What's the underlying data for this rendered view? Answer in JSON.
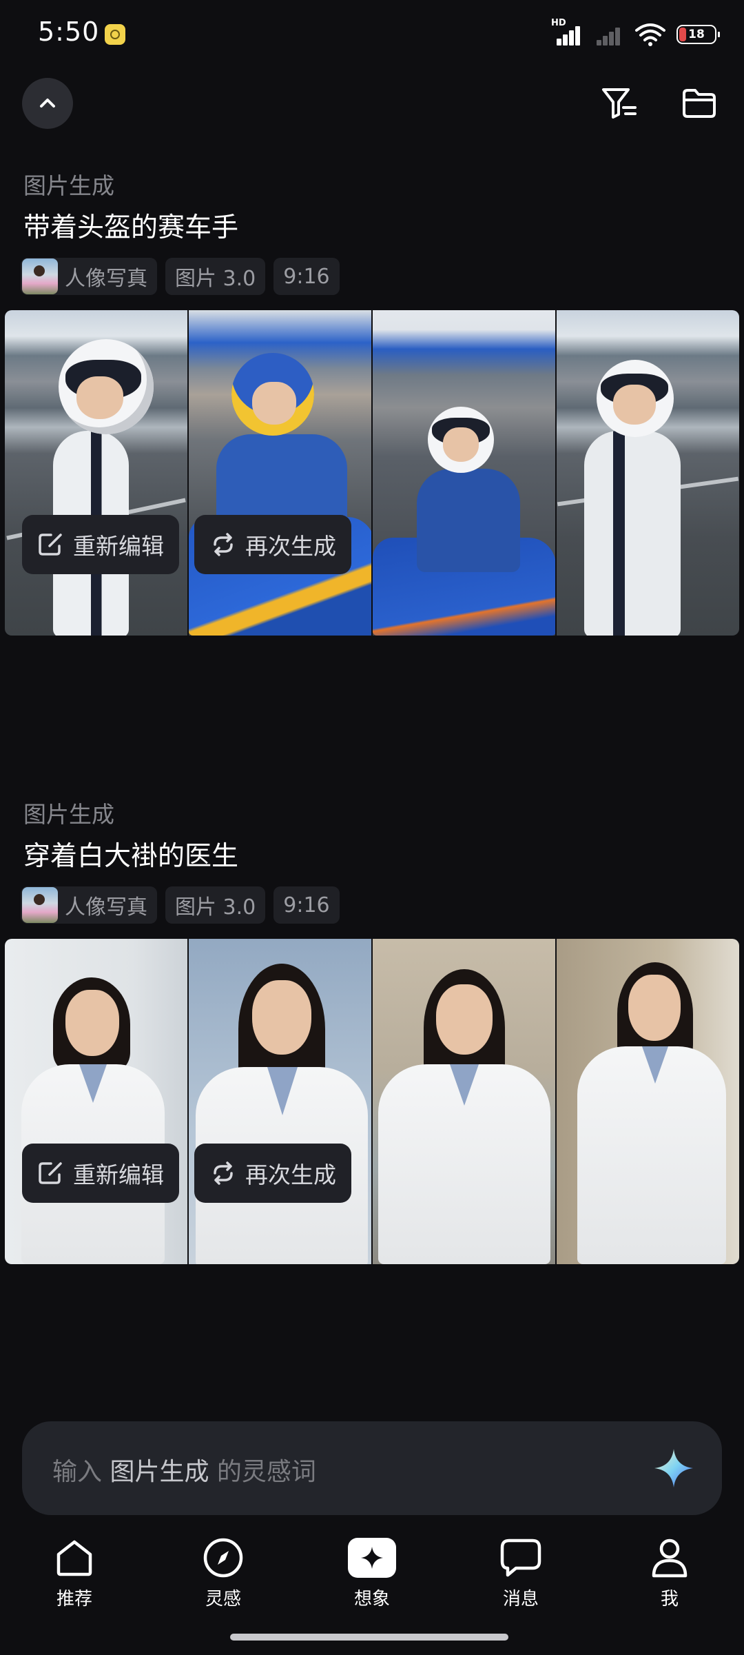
{
  "status_bar": {
    "time": "5:50",
    "network_label": "HD",
    "battery": "18"
  },
  "toolbar": {
    "collapse_icon": "chevron-up-icon",
    "filter_icon": "filter-icon",
    "folder_icon": "folder-icon"
  },
  "generations": [
    {
      "type_label": "图片生成",
      "prompt": "带着头盔的赛车手",
      "tags": {
        "style": "人像写真",
        "model": "图片 3.0",
        "ratio": "9:16"
      },
      "actions": {
        "reedit": "重新编辑",
        "regenerate": "再次生成"
      }
    },
    {
      "type_label": "图片生成",
      "prompt": "穿着白大褂的医生",
      "tags": {
        "style": "人像写真",
        "model": "图片 3.0",
        "ratio": "9:16"
      },
      "actions": {
        "reedit": "重新编辑",
        "regenerate": "再次生成"
      }
    }
  ],
  "input": {
    "prefix": "输入 ",
    "highlight": "图片生成",
    "suffix": " 的灵感词"
  },
  "nav": {
    "items": [
      {
        "label": "推荐",
        "icon": "home-icon"
      },
      {
        "label": "灵感",
        "icon": "compass-icon"
      },
      {
        "label": "想象",
        "icon": "sparkle-icon"
      },
      {
        "label": "消息",
        "icon": "chat-icon"
      },
      {
        "label": "我",
        "icon": "person-icon"
      }
    ],
    "active": "想象"
  },
  "colors": {
    "background": "#0e0e11",
    "card": "#202127",
    "muted_text": "#85868c",
    "accent": "#ffffff"
  }
}
